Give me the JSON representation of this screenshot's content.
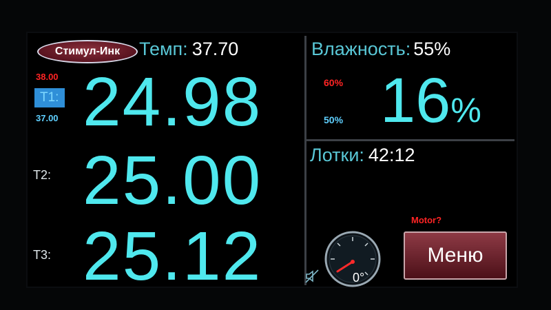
{
  "header": {
    "logo_text": "Стимул-Инк",
    "tempo_label": "Темп:",
    "tempo_value": "37.70"
  },
  "temperatures": {
    "t1": {
      "label": "T1:",
      "value": "24.98",
      "high": "38.00",
      "low": "37.00"
    },
    "t2": {
      "label": "T2:",
      "value": "25.00"
    },
    "t3": {
      "label": "T3:",
      "value": "25.12"
    }
  },
  "humidity": {
    "label": "Влажность:",
    "target": "55%",
    "value": "16",
    "unit": "%",
    "high": "60%",
    "low": "50%"
  },
  "trays": {
    "label": "Лотки:",
    "value": "42:12"
  },
  "motor": {
    "status": "Motor?",
    "gauge_value": "0°"
  },
  "menu": {
    "label": "Меню"
  },
  "icons": {
    "mute": "speaker-muted-icon",
    "gauge": "gauge-dial-icon"
  },
  "colors": {
    "digits": "#4fe8ee",
    "label": "#59c7d6",
    "high_limit": "#ff2424",
    "low_limit": "#5fd0ff",
    "button": "#7a2733"
  }
}
